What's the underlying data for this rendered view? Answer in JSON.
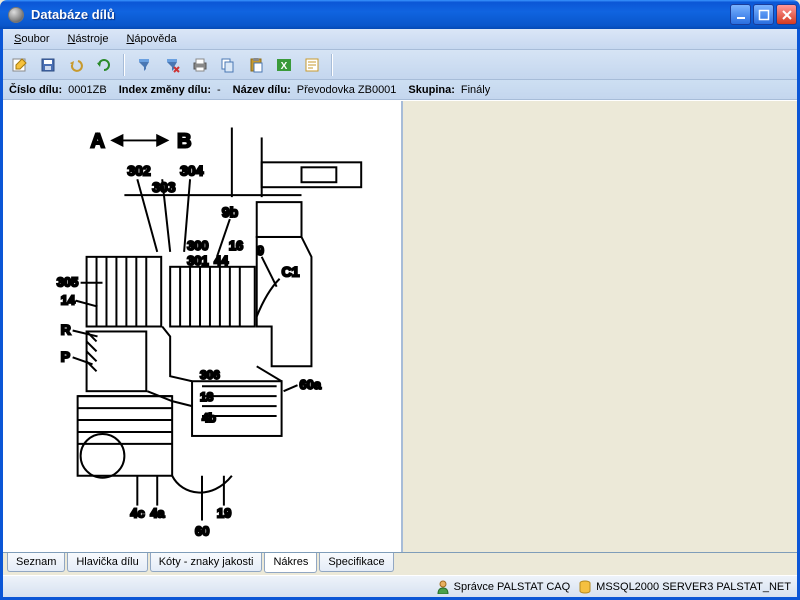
{
  "window": {
    "title": "Databáze dílů"
  },
  "menu": {
    "file": "Soubor",
    "tools": "Nástroje",
    "help": "Nápověda"
  },
  "info": {
    "part_no_label": "Číslo dílu:",
    "part_no": "0001ZB",
    "change_idx_label": "Index změny dílu:",
    "change_idx": "-",
    "name_label": "Název dílu:",
    "name": "Převodovka ZB0001",
    "group_label": "Skupina:",
    "group": "Finály"
  },
  "tabs": {
    "list": "Seznam",
    "header": "Hlavička dílu",
    "quotas": "Kóty - znaky jakosti",
    "drawing": "Nákres",
    "spec": "Specifikace"
  },
  "status": {
    "user": "Správce PALSTAT CAQ",
    "db": "MSSQL2000 SERVER3 PALSTAT_NET"
  },
  "drawing": {
    "arrow_a": "A",
    "arrow_b": "B",
    "labels": [
      "302",
      "303",
      "304",
      "9b",
      "300",
      "301",
      "44",
      "16",
      "9",
      "C1",
      "305",
      "14",
      "R",
      "P",
      "306",
      "18",
      "4b",
      "60a",
      "4c",
      "4a",
      "60",
      "19"
    ]
  }
}
